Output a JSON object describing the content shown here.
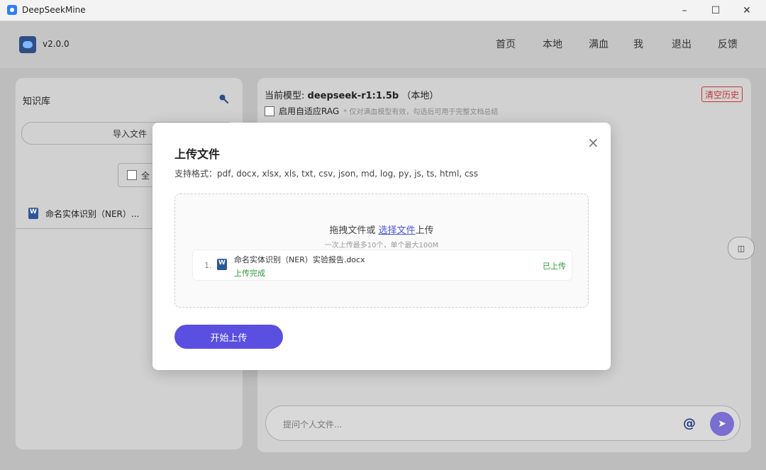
{
  "window": {
    "title": "DeepSeekMine",
    "minimize": "–",
    "maximize": "☐",
    "close": "✕"
  },
  "header": {
    "version": "v2.0.0",
    "nav": [
      "首页",
      "本地",
      "满血",
      "我",
      "退出",
      "反馈"
    ]
  },
  "sidebar": {
    "title": "知识库",
    "import_label": "导入文件",
    "select_all_label": "全",
    "file_item": "命名实体识别（NER）..."
  },
  "chat": {
    "model_prefix": "当前模型:",
    "model_name": "deepseek-r1:1.5b",
    "model_suffix": "（本地）",
    "clear_label": "清空历史",
    "rag_label": "启用自适应RAG",
    "rag_hint": "* 仅对满血模型有效，勾选后可用于完整文档总结",
    "collapse_icon": "◫",
    "prompt_placeholder": "提问个人文件...",
    "at_symbol": "@",
    "send_symbol": "➤"
  },
  "upload_dialog": {
    "title": "上传文件",
    "formats": "支持格式：pdf, docx, xlsx, xls, txt, csv, json, md, log, py, js, ts, html, css",
    "drop_text_before": "拖拽文件或 ",
    "drop_link": "选择文件",
    "drop_text_after": "上传",
    "drop_hint": "一次上传最多10个，单个最大100M",
    "close_symbol": "×",
    "files": [
      {
        "index": "1.",
        "name": "命名实体识别（NER）实验报告.docx",
        "status": "上传完成",
        "badge": "已上传"
      }
    ],
    "start_label": "开始上传"
  },
  "colors": {
    "accent": "#5a4fe0",
    "success": "#2e9d3a",
    "danger": "#cc3333"
  }
}
